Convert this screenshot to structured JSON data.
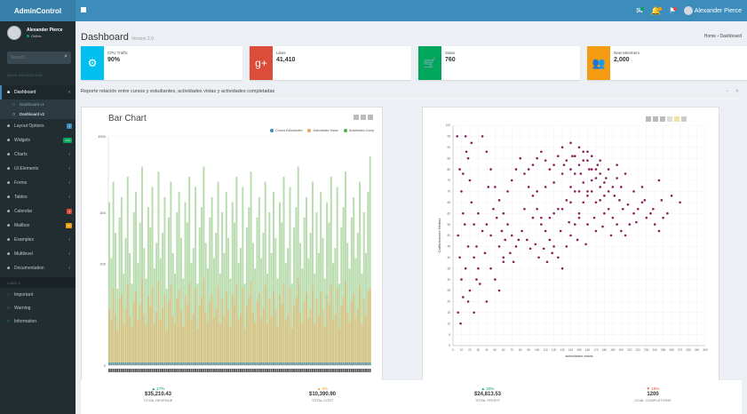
{
  "logo": "AdminControl",
  "topbar": {
    "icons": [
      {
        "name": "envelope-icon",
        "badge_color": "#00a65a"
      },
      {
        "name": "bell-icon",
        "badge_color": "#f39c12"
      },
      {
        "name": "flag-icon",
        "badge_color": "#dd4b39"
      }
    ],
    "user_name": "Alexander Pierce"
  },
  "sidebar": {
    "user_name": "Alexander Pierce",
    "user_status": "Online",
    "search_placeholder": "Search...",
    "nav_header": "MAIN NAVIGATION",
    "menu": [
      {
        "label": "Dashboard",
        "icon": "dashboard-icon",
        "active": true
      },
      {
        "label": "Layout Options",
        "icon": "files-icon",
        "badge": "4",
        "badge_color": "#3c8dbc"
      },
      {
        "label": "Widgets",
        "icon": "th-icon",
        "badge": "new",
        "badge_color": "#00a65a"
      },
      {
        "label": "Charts",
        "icon": "pie-chart-icon"
      },
      {
        "label": "UI Elements",
        "icon": "laptop-icon"
      },
      {
        "label": "Forms",
        "icon": "edit-icon"
      },
      {
        "label": "Tables",
        "icon": "table-icon"
      },
      {
        "label": "Calendar",
        "icon": "calendar-icon",
        "badge": "3",
        "badge_color": "#dd4b39"
      },
      {
        "label": "Mailbox",
        "icon": "envelope-icon",
        "badge": "12",
        "badge_color": "#f39c12"
      },
      {
        "label": "Examples",
        "icon": "folder-icon"
      },
      {
        "label": "Multilevel",
        "icon": "share-icon"
      },
      {
        "label": "Documentation",
        "icon": "book-icon"
      }
    ],
    "submenu": [
      "Dashboard v1",
      "Dashboard v2"
    ],
    "labels_header": "LABELS",
    "labels": [
      {
        "label": "Important",
        "color": "#dd4b39"
      },
      {
        "label": "Warning",
        "color": "#f39c12"
      },
      {
        "label": "Information",
        "color": "#00c0ef"
      }
    ]
  },
  "page": {
    "title": "Dashboard",
    "subtitle": "Version 2.0",
    "breadcrumb": "Home › Dashboard"
  },
  "infoboxes": [
    {
      "label": "CPU Traffic",
      "value": "90%",
      "color": "#00c0ef",
      "icon": "gear-icon"
    },
    {
      "label": "Likes",
      "value": "41,410",
      "color": "#dd4b39",
      "icon": "google-plus-icon"
    },
    {
      "label": "Sales",
      "value": "760",
      "color": "#00a65a",
      "icon": "cart-icon"
    },
    {
      "label": "New Members",
      "value": "2,000",
      "color": "#f39c12",
      "icon": "users-icon"
    }
  ],
  "panel": {
    "title": "Reporte relación entre cursos y estudiantes, actividades vistas y actividades completadas"
  },
  "bar_controls": [
    "Reset",
    "Zoom",
    "Save"
  ],
  "scatter_controls": [
    "Reset",
    "Zoom",
    "Save"
  ],
  "chart_data": [
    {
      "type": "bar",
      "title": "Bar Chart",
      "series": [
        {
          "name": "Cursos Estudiantes",
          "color": "#3c8dbc"
        },
        {
          "name": "Actividades Vistas",
          "color": "#e8a25a"
        },
        {
          "name": "Actividades Comp.",
          "color": "#4caf50"
        }
      ],
      "ylim": [
        0,
        4500
      ],
      "yticks": [
        "4500",
        "300",
        "200",
        "0"
      ],
      "green_heights": [
        3200,
        2100,
        3600,
        2600,
        1500,
        2900,
        3300,
        1800,
        2500,
        3700,
        2200,
        1600,
        3000,
        3400,
        2000,
        2800,
        3900,
        2300,
        1700,
        3100,
        2700,
        3500,
        1900,
        2400,
        3800,
        2100,
        2600,
        3300,
        1500,
        2900,
        3600,
        2200,
        1800,
        3000,
        3400,
        2500,
        1700,
        3200,
        2800,
        3700,
        2000,
        2300,
        3500,
        1600,
        2700,
        3100,
        3900,
        2400,
        1900,
        2900,
        3300,
        2100,
        2600,
        3600,
        1800,
        3000,
        2200,
        3400,
        2500,
        1700,
        3200,
        2800,
        3700,
        2000,
        2300,
        3500,
        1600,
        2700,
        3100,
        3800,
        2400,
        1900,
        2900,
        3300,
        2100,
        2600,
        3600,
        1800,
        3000,
        2200,
        3400,
        2500,
        1700,
        3200,
        2800,
        3700,
        2000,
        2300,
        3500,
        1600,
        2700,
        3100,
        3900,
        2400,
        1900,
        2900,
        3300,
        2100,
        2600,
        3600,
        1800,
        3000,
        2200,
        3400,
        2500,
        1700,
        3200,
        2800,
        3700,
        2000,
        2300,
        3500,
        1600,
        2700,
        3100,
        3800,
        2400,
        1900,
        2900,
        3300,
        2100,
        2600,
        3600,
        1800,
        3000,
        2200,
        3400,
        4100
      ],
      "orange_heights": [
        1100,
        900,
        1500,
        1000,
        700,
        1300,
        1400,
        800,
        1100,
        1600,
        950,
        750,
        1250,
        1450,
        880,
        1200,
        1700,
        1000,
        780,
        1350,
        1150,
        1550,
        820,
        1050,
        1650,
        900,
        1120,
        1400,
        700,
        1260,
        1580,
        960,
        800,
        1300,
        1480,
        1080,
        760,
        1380,
        1200,
        1620,
        880,
        1000,
        1520,
        720,
        1160,
        1340,
        1700,
        1040,
        840,
        1260,
        1420,
        920,
        1120,
        1560,
        800,
        1300,
        960,
        1460,
        1080,
        760,
        1380,
        1200,
        1600,
        880,
        1000,
        1520,
        720,
        1160,
        1340,
        1650,
        1040,
        840,
        1260,
        1420,
        920,
        1120,
        1560,
        800,
        1300,
        960,
        1460,
        1080,
        760,
        1380,
        1200,
        1600,
        880,
        1000,
        1520,
        720,
        1160,
        1340,
        1700,
        1040,
        840,
        1260,
        1420,
        920,
        1120,
        1560,
        800,
        1300,
        960,
        1460,
        1080,
        760,
        1380,
        1200,
        1600,
        880,
        1000,
        1520,
        720,
        1160,
        1340,
        1650,
        1040,
        840,
        1260,
        1420,
        920,
        1120,
        1560,
        800,
        1300,
        960,
        1460,
        1500
      ]
    },
    {
      "type": "scatter",
      "title": "",
      "xlabel": "actividades vistas",
      "ylabel": "Calificaciones Medias",
      "xlim": [
        0,
        300
      ],
      "ylim": [
        0,
        100
      ],
      "color": "#8b1f5a",
      "points": [
        [
          5,
          95
        ],
        [
          8,
          80
        ],
        [
          10,
          70
        ],
        [
          12,
          60
        ],
        [
          6,
          50
        ],
        [
          8,
          40
        ],
        [
          10,
          30
        ],
        [
          12,
          22
        ],
        [
          6,
          15
        ],
        [
          9,
          10
        ],
        [
          15,
          95
        ],
        [
          18,
          85
        ],
        [
          20,
          75
        ],
        [
          22,
          65
        ],
        [
          25,
          55
        ],
        [
          28,
          45
        ],
        [
          30,
          35
        ],
        [
          20,
          25
        ],
        [
          18,
          20
        ],
        [
          25,
          15
        ],
        [
          35,
          95
        ],
        [
          40,
          88
        ],
        [
          45,
          80
        ],
        [
          50,
          72
        ],
        [
          55,
          66
        ],
        [
          60,
          60
        ],
        [
          65,
          55
        ],
        [
          70,
          50
        ],
        [
          75,
          45
        ],
        [
          45,
          35
        ],
        [
          50,
          30
        ],
        [
          55,
          25
        ],
        [
          40,
          20
        ],
        [
          60,
          40
        ],
        [
          65,
          70
        ],
        [
          70,
          75
        ],
        [
          75,
          80
        ],
        [
          80,
          85
        ],
        [
          85,
          78
        ],
        [
          90,
          72
        ],
        [
          95,
          68
        ],
        [
          100,
          62
        ],
        [
          105,
          58
        ],
        [
          110,
          52
        ],
        [
          115,
          48
        ],
        [
          120,
          45
        ],
        [
          125,
          40
        ],
        [
          130,
          35
        ],
        [
          135,
          45
        ],
        [
          140,
          50
        ],
        [
          145,
          55
        ],
        [
          150,
          60
        ],
        [
          155,
          65
        ],
        [
          160,
          70
        ],
        [
          165,
          75
        ],
        [
          170,
          80
        ],
        [
          175,
          72
        ],
        [
          180,
          68
        ],
        [
          185,
          62
        ],
        [
          190,
          58
        ],
        [
          195,
          55
        ],
        [
          200,
          52
        ],
        [
          205,
          50
        ],
        [
          210,
          55
        ],
        [
          215,
          60
        ],
        [
          220,
          62
        ],
        [
          225,
          65
        ],
        [
          230,
          58
        ],
        [
          235,
          60
        ],
        [
          240,
          55
        ],
        [
          245,
          52
        ],
        [
          250,
          58
        ],
        [
          255,
          60
        ],
        [
          90,
          80
        ],
        [
          95,
          82
        ],
        [
          100,
          85
        ],
        [
          105,
          88
        ],
        [
          110,
          84
        ],
        [
          115,
          80
        ],
        [
          120,
          82
        ],
        [
          125,
          86
        ],
        [
          130,
          90
        ],
        [
          135,
          84
        ],
        [
          140,
          80
        ],
        [
          145,
          78
        ],
        [
          150,
          82
        ],
        [
          155,
          88
        ],
        [
          160,
          84
        ],
        [
          165,
          80
        ],
        [
          170,
          76
        ],
        [
          175,
          78
        ],
        [
          180,
          74
        ],
        [
          185,
          70
        ],
        [
          190,
          72
        ],
        [
          195,
          76
        ],
        [
          200,
          72
        ],
        [
          100,
          70
        ],
        [
          110,
          72
        ],
        [
          120,
          74
        ],
        [
          130,
          78
        ],
        [
          140,
          72
        ],
        [
          150,
          70
        ],
        [
          160,
          68
        ],
        [
          170,
          65
        ],
        [
          180,
          60
        ],
        [
          120,
          60
        ],
        [
          130,
          62
        ],
        [
          140,
          65
        ],
        [
          150,
          58
        ],
        [
          160,
          55
        ],
        [
          170,
          52
        ],
        [
          85,
          62
        ],
        [
          95,
          58
        ],
        [
          105,
          55
        ],
        [
          115,
          58
        ],
        [
          125,
          62
        ],
        [
          135,
          66
        ],
        [
          145,
          70
        ],
        [
          155,
          74
        ],
        [
          165,
          70
        ],
        [
          175,
          66
        ],
        [
          185,
          80
        ],
        [
          195,
          82
        ],
        [
          205,
          78
        ],
        [
          215,
          70
        ],
        [
          225,
          72
        ],
        [
          245,
          75
        ],
        [
          260,
          68
        ],
        [
          270,
          65
        ],
        [
          40,
          55
        ],
        [
          45,
          50
        ],
        [
          55,
          45
        ],
        [
          60,
          38
        ],
        [
          30,
          60
        ],
        [
          35,
          52
        ],
        [
          38,
          42
        ],
        [
          25,
          40
        ],
        [
          28,
          30
        ],
        [
          32,
          28
        ],
        [
          15,
          35
        ],
        [
          18,
          45
        ],
        [
          14,
          55
        ],
        [
          12,
          78
        ],
        [
          16,
          88
        ],
        [
          22,
          92
        ],
        [
          42,
          72
        ],
        [
          48,
          62
        ],
        [
          52,
          58
        ],
        [
          58,
          52
        ],
        [
          62,
          48
        ],
        [
          68,
          42
        ],
        [
          72,
          38
        ],
        [
          78,
          48
        ],
        [
          82,
          52
        ],
        [
          88,
          48
        ],
        [
          92,
          44
        ],
        [
          98,
          46
        ],
        [
          102,
          40
        ],
        [
          108,
          44
        ],
        [
          112,
          38
        ],
        [
          118,
          42
        ],
        [
          128,
          52
        ],
        [
          138,
          56
        ],
        [
          148,
          48
        ],
        [
          158,
          46
        ],
        [
          168,
          58
        ],
        [
          178,
          54
        ],
        [
          188,
          50
        ],
        [
          198,
          66
        ],
        [
          208,
          64
        ],
        [
          218,
          56
        ],
        [
          228,
          66
        ],
        [
          238,
          62
        ],
        [
          248,
          66
        ],
        [
          140,
          92
        ],
        [
          150,
          90
        ],
        [
          160,
          88
        ],
        [
          145,
          86
        ],
        [
          155,
          84
        ],
        [
          165,
          86
        ],
        [
          175,
          84
        ],
        [
          132,
          82
        ],
        [
          142,
          86
        ],
        [
          152,
          78
        ],
        [
          162,
          80
        ],
        [
          172,
          82
        ],
        [
          182,
          76
        ],
        [
          192,
          68
        ],
        [
          202,
          62
        ]
      ]
    }
  ],
  "footer_stats": [
    {
      "pct": "▲ 17%",
      "amount": "$35,210.43",
      "name": "TOTAL REVENUE",
      "color": "#00a65a"
    },
    {
      "pct": "▲ 0%",
      "amount": "$10,390.90",
      "name": "TOTAL COST",
      "color": "#f39c12"
    },
    {
      "pct": "▲ 20%",
      "amount": "$24,813.53",
      "name": "TOTAL PROFIT",
      "color": "#00a65a"
    },
    {
      "pct": "▼ 18%",
      "amount": "1200",
      "name": "GOAL COMPLETIONS",
      "color": "#dd4b39"
    }
  ]
}
